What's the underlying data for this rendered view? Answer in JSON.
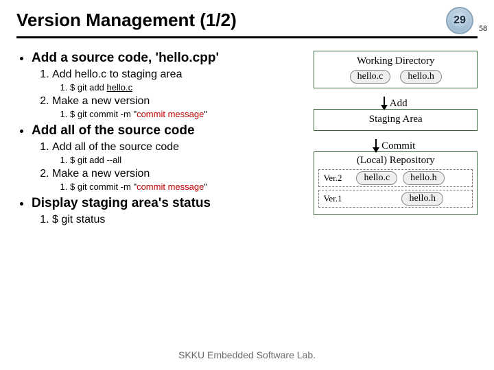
{
  "title": "Version Management (1/2)",
  "page_number": "29",
  "sub_page_number": "58",
  "bullets": {
    "b1": {
      "title": "Add a source code, 'hello.cpp'",
      "s1": {
        "text": "Add hello.c to staging area",
        "cmd_prefix": "$ git add ",
        "cmd_arg": "hello.c"
      },
      "s2": {
        "text": "Make a new version",
        "cmd_prefix": "$ git commit -m \"",
        "cmd_msg": "commit message",
        "cmd_suffix": "\""
      }
    },
    "b2": {
      "title": "Add all of the source code",
      "s1": {
        "text": "Add all of the source code",
        "cmd": "$ git add --all"
      },
      "s2": {
        "text": "Make a new version",
        "cmd_prefix": "$ git commit -m \"",
        "cmd_msg": "commit message",
        "cmd_suffix": "\""
      }
    },
    "b3": {
      "title": "Display staging area's status",
      "s1": {
        "cmd": "$ git status"
      }
    }
  },
  "diagram": {
    "wd": {
      "label": "Working Directory",
      "f1": "hello.c",
      "f2": "hello.h"
    },
    "arrow1": "Add",
    "sa": {
      "label": "Staging Area"
    },
    "arrow2": "Commit",
    "repo": {
      "label": "(Local) Repository",
      "ver2": {
        "name": "Ver.2",
        "f1": "hello.c",
        "f2": "hello.h"
      },
      "ver1": {
        "name": "Ver.1",
        "f2": "hello.h"
      }
    }
  },
  "footer": "SKKU Embedded Software Lab."
}
